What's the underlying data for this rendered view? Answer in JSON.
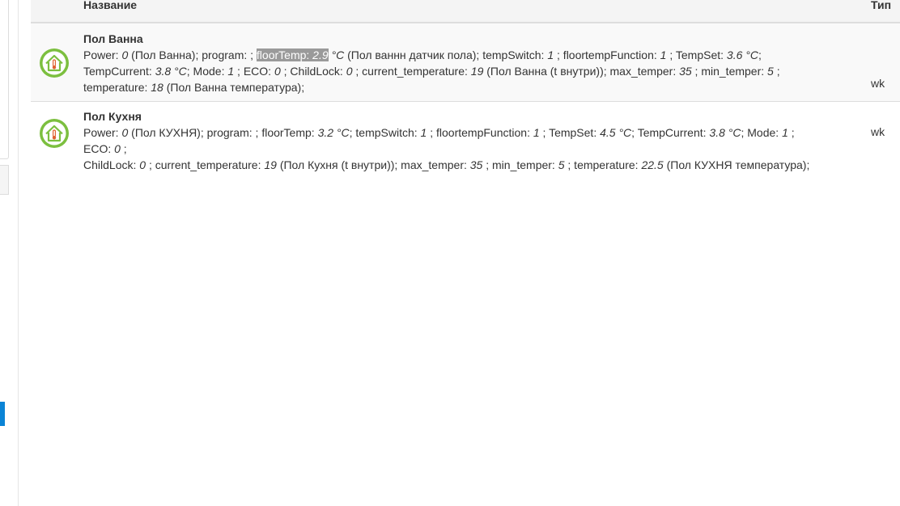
{
  "table": {
    "headers": {
      "name": "Название",
      "type": "Тип"
    },
    "rows": [
      {
        "name": "Пол Ванна",
        "type": "wk",
        "icon": "thermometer-home-icon",
        "props": {
          "power_label": "Power: ",
          "power_val": "0",
          "power_note": " (Пол Ванна); program: ; ",
          "floor_label": "floorTemp: ",
          "floor_val": "2.9",
          "floor_unit": " °C",
          "floor_note": " (Пол ваннн датчик пола); tempSwitch: ",
          "tempswitch_val": "1",
          "ftf_label": " ; floortempFunction: ",
          "ftf_val": "1",
          "tempset_label": " ; TempSet: ",
          "tempset_val": "3.6 °C",
          "tempcur_label": "; TempCurrent: ",
          "tempcur_val": "3.8 °C",
          "mode_label": "; Mode: ",
          "mode_val": "1",
          "eco_label": " ; ECO: ",
          "eco_val": "0",
          "child_label": " ; ChildLock: ",
          "child_val": "0",
          "curtemp_label": " ; current_temperature: ",
          "curtemp_val": "19",
          "curtemp_note": " (Пол Ванна (t внутри)); max_temper: ",
          "max_val": "35",
          "min_label": " ; min_temper: ",
          "min_val": "5",
          "temp_label": " ; temperature: ",
          "temp_val": "18",
          "temp_note": " (Пол Ванна температура);"
        }
      },
      {
        "name": "Пол Кухня",
        "type": "wk",
        "icon": "thermometer-home-icon",
        "props": {
          "power_label": "Power: ",
          "power_val": "0",
          "power_note": " (Пол КУХНЯ); program: ; floorTemp: ",
          "floor_val": "3.2 °C",
          "tempswitch_label": "; tempSwitch: ",
          "tempswitch_val": "1",
          "ftf_label": " ; floortempFunction: ",
          "ftf_val": "1",
          "tempset_label": " ; TempSet: ",
          "tempset_val": "4.5 °C",
          "tempcur_label": "; TempCurrent: ",
          "tempcur_val": "3.8 °C",
          "mode_label": "; Mode: ",
          "mode_val": "1",
          "eco_label": " ; ECO: ",
          "eco_val": "0",
          "child_label": " ;",
          "child_label2": "ChildLock: ",
          "child_val": "0",
          "curtemp_label": " ; current_temperature: ",
          "curtemp_val": "19",
          "curtemp_note": " (Пол Кухня (t внутри)); max_temper: ",
          "max_val": "35",
          "min_label": " ; min_temper: ",
          "min_val": "5",
          "temp_label": " ; temperature: ",
          "temp_val": "22.5",
          "temp_note": " (Пол КУХНЯ температура);"
        }
      }
    ]
  },
  "colors": {
    "icon_ring": "#7cbf3f",
    "highlight": "#9a9a9a",
    "accent": "#0a84d6"
  }
}
